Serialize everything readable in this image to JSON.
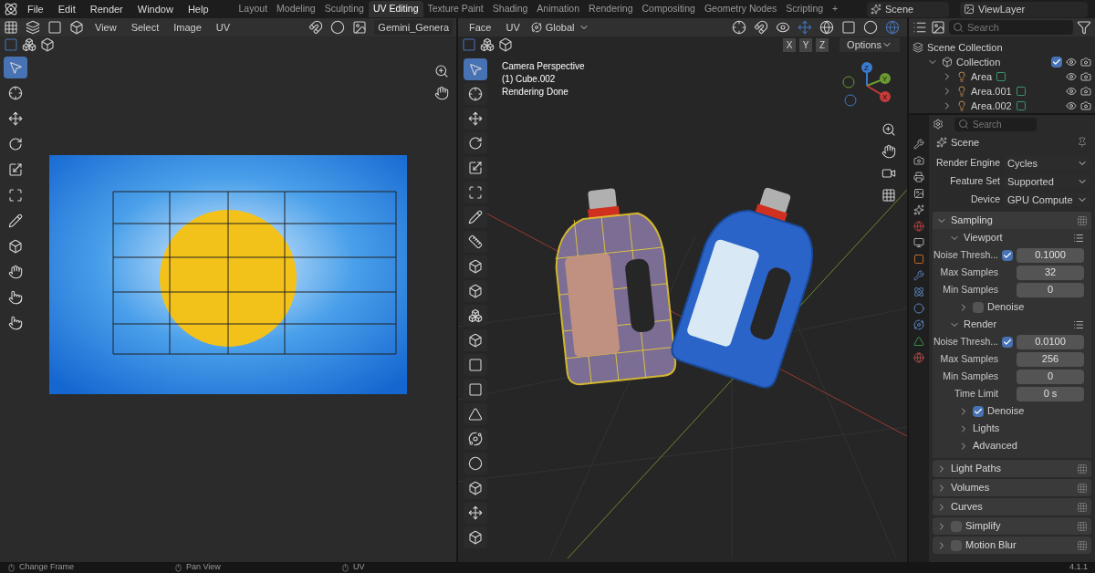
{
  "menu": [
    "File",
    "Edit",
    "Render",
    "Window",
    "Help"
  ],
  "workspaces": [
    {
      "label": "Layout",
      "selected": false
    },
    {
      "label": "Modeling",
      "selected": false
    },
    {
      "label": "Sculpting",
      "selected": false
    },
    {
      "label": "UV Editing",
      "selected": true
    },
    {
      "label": "Texture Paint",
      "selected": false
    },
    {
      "label": "Shading",
      "selected": false
    },
    {
      "label": "Animation",
      "selected": false
    },
    {
      "label": "Rendering",
      "selected": false
    },
    {
      "label": "Compositing",
      "selected": false
    },
    {
      "label": "Geometry Nodes",
      "selected": false
    },
    {
      "label": "Scripting",
      "selected": false
    },
    {
      "label": "+",
      "selected": false
    }
  ],
  "scene": "Scene",
  "view_layer": "ViewLayer",
  "uv_editor": {
    "menus": [
      "View",
      "Select",
      "Image",
      "UV"
    ],
    "image_name": "Gemini_Genera"
  },
  "viewport": {
    "menus": [
      "Face",
      "UV"
    ],
    "orientation": "Global",
    "axes": [
      "X",
      "Y",
      "Z"
    ],
    "options": "Options",
    "overlay": [
      "Camera Perspective",
      "(1) Cube.002",
      "Rendering Done"
    ],
    "gizmo_axes": [
      "Z",
      "Y",
      "X"
    ]
  },
  "outliner": {
    "search": {
      "placeholder": "Search"
    },
    "items": [
      {
        "label": "Scene Collection",
        "children": [
          {
            "label": "Collection",
            "expanded": true,
            "checked": true,
            "children": [
              {
                "label": "Area",
                "expanded": false
              },
              {
                "label": "Area.001",
                "expanded": false
              },
              {
                "label": "Area.002",
                "expanded": false
              }
            ]
          }
        ]
      }
    ]
  },
  "properties": {
    "search": {
      "placeholder": "Search"
    },
    "context": "Scene",
    "fields": [
      {
        "label": "Render Engine",
        "value": "Cycles"
      },
      {
        "label": "Feature Set",
        "value": "Supported"
      },
      {
        "label": "Device",
        "value": "GPU Compute"
      }
    ],
    "panels": [
      {
        "title": "Sampling",
        "expanded": true,
        "children": [
          {
            "kind": "subpanel",
            "title": "Viewport",
            "expanded": true,
            "children": [
              {
                "kind": "toggle_number",
                "label": "Noise Thresh...",
                "checked": true,
                "value": "0.1000"
              },
              {
                "kind": "number",
                "label": "Max Samples",
                "value": "32"
              },
              {
                "kind": "number",
                "label": "Min Samples",
                "value": "0"
              },
              {
                "kind": "subpanel",
                "title": "Denoise",
                "expanded": false,
                "checked": false
              }
            ]
          },
          {
            "kind": "subpanel",
            "title": "Render",
            "expanded": true,
            "children": [
              {
                "kind": "toggle_number",
                "label": "Noise Thresh...",
                "checked": true,
                "value": "0.0100"
              },
              {
                "kind": "number",
                "label": "Max Samples",
                "value": "256"
              },
              {
                "kind": "number",
                "label": "Min Samples",
                "value": "0"
              },
              {
                "kind": "number",
                "label": "Time Limit",
                "value": "0 s"
              },
              {
                "kind": "subpanel",
                "title": "Denoise",
                "expanded": false,
                "checked": true
              },
              {
                "kind": "subpanel",
                "title": "Lights",
                "expanded": false
              },
              {
                "kind": "subpanel",
                "title": "Advanced",
                "expanded": false
              }
            ]
          }
        ]
      },
      {
        "title": "Light Paths",
        "expanded": false
      },
      {
        "title": "Volumes",
        "expanded": false
      },
      {
        "title": "Curves",
        "expanded": false
      },
      {
        "title": "Simplify",
        "expanded": false,
        "checked": false
      },
      {
        "title": "Motion Blur",
        "expanded": false,
        "checked": false
      }
    ]
  },
  "status_bar": {
    "hints": [
      "Change Frame",
      "Pan View",
      "UV"
    ],
    "version": "4.1.1"
  }
}
